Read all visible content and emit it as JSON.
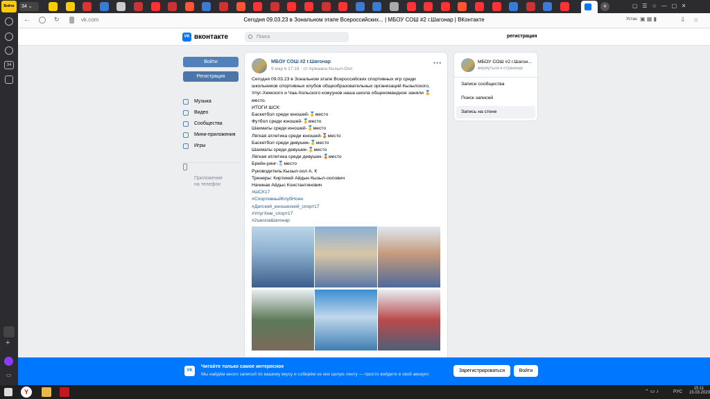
{
  "browser": {
    "tab_count_badge": "34",
    "panel_badge": "34",
    "corner_label": "Войти",
    "url": "vk.com",
    "page_title": "Сегодня 09.03.23 в Зональном этапе Всероссийских... | МБОУ СОШ #2 г.Шагонар | ВКонтакте",
    "extra_label": "Устан"
  },
  "vk": {
    "logo_text": "вконтакте",
    "logo_mark": "VK",
    "search_placeholder": "Поиск",
    "header_register": "регистрация",
    "login_button": "Войти",
    "register_button": "Регистрация",
    "nav": [
      {
        "label": "Музыка",
        "icon": "music-icon"
      },
      {
        "label": "Видео",
        "icon": "video-icon"
      },
      {
        "label": "Сообщества",
        "icon": "communities-icon"
      },
      {
        "label": "Мини-приложения",
        "icon": "apps-icon"
      },
      {
        "label": "Игры",
        "icon": "games-icon"
      }
    ],
    "app_promo": "Приложение\nна телефон"
  },
  "post": {
    "author": "МБОУ СОШ #2 г.Шагонар",
    "meta": "9 мар в 17:19   ·   от Аржаана Кызыл-Оол",
    "lines": [
      "Сегодня 09.03.23 в Зональном этапе Всероссийских спортивных игр среди",
      "школьников спортивных клубов общеобразовательных организаций Кызылского,",
      "Улуг-Хемского и Чаа-Хольского кожуунов наша школа общекомандное заняли 🏅",
      "место.",
      "ИТОГИ ШСК:",
      "Баскетбол среди юношей-🥇место",
      "Футбол среди юношей-🥇место",
      "Шахматы среди юношей-🥇место",
      "Лёгкая атлетика среди юношей-🥉место",
      "Баскетбол среди девушек-🥇место",
      "Шахматы среди девушек-🥇место",
      "Лёгкая атлетика среди девушек-🥉место",
      "Брейн-ринг-🥈место",
      "Руководитель:Кызыл-оол А. К",
      "Тренеры: Киртикей Айдын Кызыл-оолович",
      "Начинак Айдыс Константинович"
    ],
    "tags": [
      "#ШСК17",
      "#СпортивныйКлубНоян",
      "#Датский_юношеский_спорт17",
      "#УлугХем_спорт17",
      "#2школаШагонар"
    ]
  },
  "right_block": {
    "name": "МБОУ СОШ #2 г.Шагон...",
    "back": "вернуться к странице",
    "items": [
      "Записи сообщества",
      "Поиск записей",
      "Запись на стене"
    ]
  },
  "banner": {
    "title": "Читайте только самое интересное",
    "subtitle": "Мы найдём много записей по вашему вкусу и соберём из них целую ленту — просто войдите в свой аккаунт.",
    "register_button": "Зарегистрироваться",
    "login_button": "Войти"
  },
  "taskbar": {
    "lang": "РУС",
    "time": "15:11",
    "date": "15.03.2023"
  }
}
